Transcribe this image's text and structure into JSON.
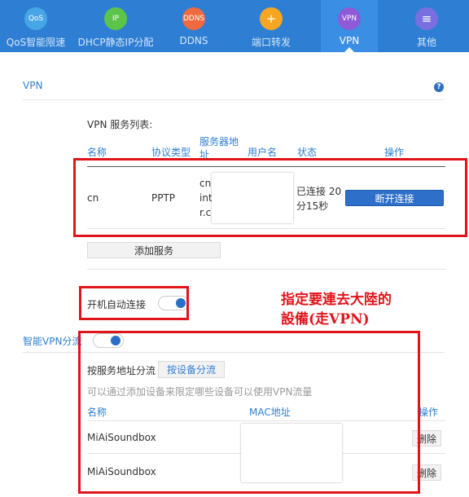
{
  "nav": {
    "items": [
      {
        "label": "QoS智能限速",
        "icon_text": "QoS",
        "color": "#46a6e6"
      },
      {
        "label": "DHCP静态IP分配",
        "icon_text": "IP",
        "color": "#5dc44a"
      },
      {
        "label": "DDNS",
        "icon_text": "DDNS",
        "color": "#f06a3f"
      },
      {
        "label": "端口转发",
        "icon_text": "+",
        "color": "#f6a623"
      },
      {
        "label": "VPN",
        "icon_text": "VPN",
        "color": "#8e5ad7"
      },
      {
        "label": "其他",
        "icon_text": "≡",
        "color": "#7a6fe0"
      }
    ],
    "active_index": 4
  },
  "vpn": {
    "title": "VPN",
    "help": "?",
    "list_title": "VPN 服务列表:",
    "headers": {
      "name": "名称",
      "protocol": "协议类型",
      "server": "服务器地址",
      "user": "用户名",
      "status": "状态",
      "action": "操作"
    },
    "row": {
      "name": "cn",
      "protocol": "PPTP",
      "server_lines": [
        "cn",
        "int",
        "r.c"
      ],
      "status_lines": [
        "已连接 20",
        "分15秒"
      ],
      "disconnect_label": "断开连接"
    },
    "add_label": "添加服务",
    "autoconnect_label": "开机自动连接",
    "autoconnect_on": true
  },
  "annotation": {
    "line1": "指定要連去大陸的",
    "line2": "設備(走VPN)",
    "color": "#e0141b"
  },
  "smart": {
    "title": "智能VPN分流",
    "enabled": true,
    "tab_server": "按服务地址分流",
    "tab_device": "按设备分流",
    "hint": "可以通过添加设备来限定哪些设备可以使用VPN流量",
    "headers": {
      "name": "名称",
      "mac": "MAC地址",
      "action": "操作"
    },
    "devices": [
      {
        "name": "MiAiSoundbox",
        "delete_label": "删除"
      },
      {
        "name": "MiAiSoundbox",
        "delete_label": "删除"
      }
    ]
  }
}
